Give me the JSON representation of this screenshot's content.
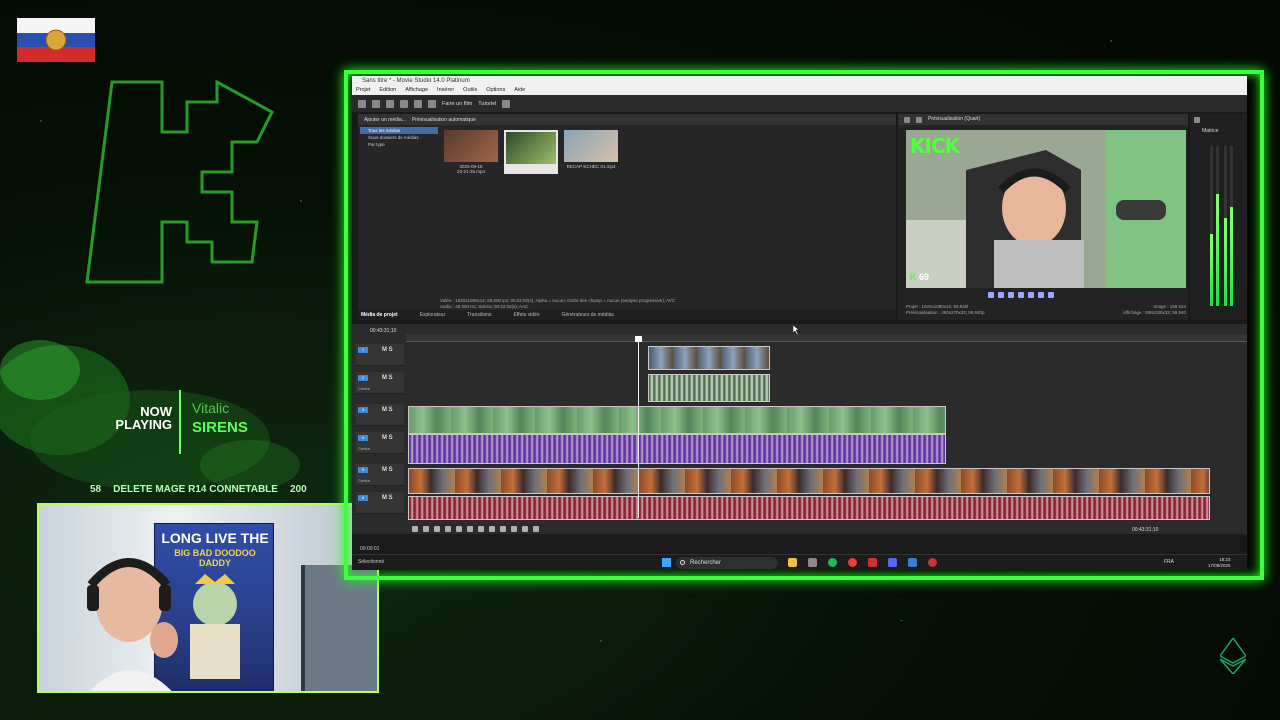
{
  "overlay": {
    "now_playing": "NOW PLAYING",
    "artist": "Vitalic",
    "track": "SIRENS",
    "ticker": {
      "left_value": "58",
      "message": "DELETE MAGE R14 CONNETABLE",
      "right_value": "200"
    },
    "icons": [
      "russia-flag-icon",
      "kick-k-logo",
      "ethereum-icon"
    ],
    "accent_color": "#3eff3e"
  },
  "webcam": {
    "poster_lines": [
      "LONG LIVE THE",
      "BIG BAD DOODOO DADDY"
    ]
  },
  "window": {
    "title": "Sans titre * - Movie Studio 14.0 Platinum",
    "menu": [
      "Projet",
      "Edition",
      "Affichage",
      "Insérer",
      "Outils",
      "Options",
      "Aide"
    ],
    "toolbar": {
      "make_movie": "Faire un film",
      "tutorial": "Tutoriel"
    },
    "media": {
      "add_media": "Ajouter un média...",
      "auto_preview": "Prévisualisation automatique",
      "tree": [
        "Tous les médias",
        "Sous-dossiers de médias",
        "Par type"
      ],
      "thumbs": [
        {
          "caption": "2025-09-16\n23-21-35.mp4"
        },
        {
          "caption": ""
        },
        {
          "caption": "RECAP ECHEC 01.mp4"
        }
      ],
      "info_line1": "Vidéo : 1920x1080x12; 60,000 ips; 00:22:02(s); Alpha = Aucun; Ordre des champ = Aucun (analyse progressive); AVC",
      "info_line2": "Audio : 48 000 Hz; Stéréo; 00:22:02(s); AAC",
      "tabs": [
        "Média de projet",
        "Explorateur",
        "Transitions",
        "Effets vidéo",
        "Générateurs de médias"
      ]
    },
    "preview": {
      "mode": "Prévisualisation (Quart)",
      "kick_logo": "KICK",
      "viewer_count": "69",
      "info_line1": "Projet : 1920x1080x32; 59,940i",
      "info_line2": "Prévisualisation : 480x270x32; 59,940p",
      "image_line1": "Image : 158 524",
      "image_line2": "Affichage : 598x336x32; 59,940"
    },
    "mixer": {
      "label": "Matrice",
      "levels": [
        0.45,
        0.7,
        0.55,
        0.62
      ]
    },
    "timeline": {
      "timecode": "00:43:31;10",
      "track_numbers": [
        "1",
        "2",
        "3",
        "4",
        "5",
        "6"
      ],
      "track_ms": "M S",
      "track_center": "Centre",
      "end_time": "00:43:31;10",
      "footer_time": "00:00:01",
      "footer_label": "Sélectionné"
    },
    "taskbar": {
      "search": "Rechercher",
      "lang": "FRA",
      "time": "18:23",
      "date": "17/09/2025"
    }
  }
}
